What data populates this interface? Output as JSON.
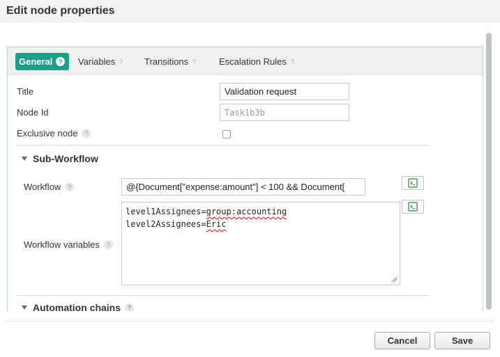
{
  "dialog": {
    "title": "Edit node properties"
  },
  "tabs": [
    {
      "label": "General",
      "help": "?"
    },
    {
      "label": "Variables",
      "help": "?"
    },
    {
      "label": "Transitions",
      "help": "?"
    },
    {
      "label": "Escalation Rules",
      "help": "?"
    }
  ],
  "general": {
    "title_label": "Title",
    "title_value": "Validation request",
    "node_id_label": "Node Id",
    "node_id_value": "Task1b3b",
    "exclusive_label": "Exclusive node",
    "help": "?"
  },
  "subworkflow": {
    "section_title": "Sub-Workflow",
    "workflow_label": "Workflow",
    "workflow_value": "@{Document[\"expense:amount\"] < 100 && Document[",
    "variables_label": "Workflow variables",
    "variables_line1_key": "level1Assignees=",
    "variables_line1_value": "group:accounting",
    "variables_line2_key": "level2Assignees=",
    "variables_line2_value": "Eric"
  },
  "automation": {
    "section_title": "Automation chains"
  },
  "footer": {
    "cancel_label": "Cancel",
    "save_label": "Save"
  },
  "colors": {
    "accent": "#1f9e87",
    "panel_border": "#bcd0dc"
  },
  "icons": {
    "script_editor": "terminal-icon",
    "section_toggle": "caret-down-icon",
    "help": "help-icon"
  }
}
